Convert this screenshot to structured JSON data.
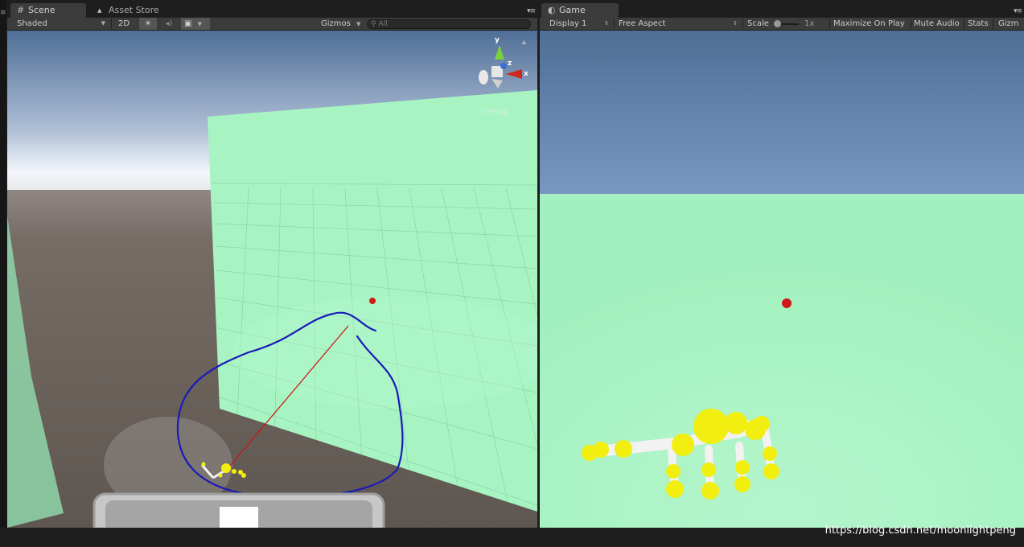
{
  "scene_panel": {
    "tabs": [
      {
        "label": "Scene",
        "icon": "scene-grid-icon",
        "active": true
      },
      {
        "label": "Asset Store",
        "icon": "asset-store-bag-icon",
        "active": false
      }
    ],
    "toolbar": {
      "draw_mode": "Shaded",
      "mode_2d": "2D",
      "lighting_icon": "sun-icon",
      "audio_icon": "speaker-icon",
      "effects_icon": "image-effects-icon",
      "gizmos": "Gizmos",
      "search_placeholder": "All"
    },
    "gizmo": {
      "y": "y",
      "z": "z",
      "x": "x"
    },
    "projection": "Persp"
  },
  "game_panel": {
    "tab": {
      "label": "Game",
      "icon": "game-pacman-icon",
      "active": true
    },
    "toolbar": {
      "display": "Display 1",
      "aspect": "Free Aspect",
      "scale_label": "Scale",
      "scale_value": "1x",
      "maximize_on_play": "Maximize On Play",
      "mute_audio": "Mute Audio",
      "stats": "Stats",
      "gizmos": "Gizm"
    }
  },
  "colors": {
    "sky_top": "#4f6e96",
    "horizon": "#f4f6fb",
    "ground": "#6e655f",
    "wall": "#a7f4c2",
    "annotation_blue": "#1a1ab8",
    "ray_red": "#d01010",
    "joint_yellow": "#f2ee10",
    "bone_white": "#f2f2f2"
  },
  "watermark": "https://blog.csdn.net/moonlightpeng"
}
